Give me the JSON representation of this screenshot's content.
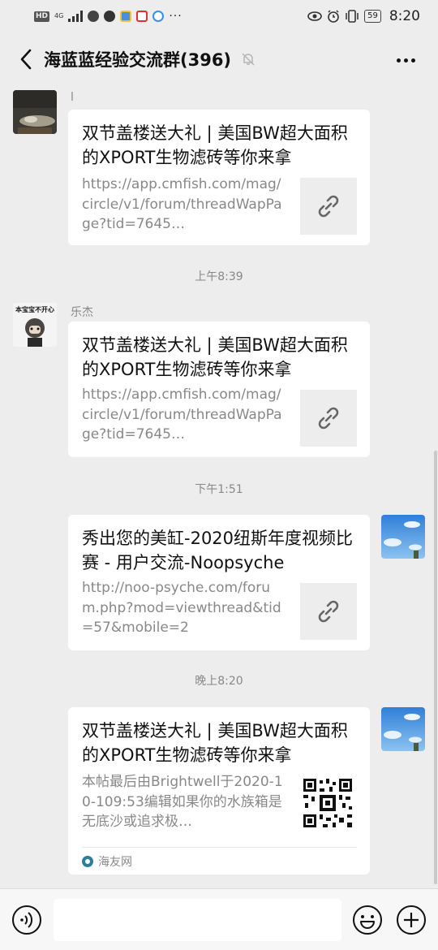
{
  "status_bar": {
    "left_badges": [
      "HD",
      "4G"
    ],
    "more": "···",
    "battery": "59",
    "time": "8:20"
  },
  "header": {
    "title": "海蓝蓝经验交流群(396)",
    "icons": [
      "back-icon",
      "mute-bell-icon",
      "more-icon"
    ]
  },
  "messages": [
    {
      "sender": "l",
      "title": "双节盖楼送大礼 | 美国BW超大面积的XPORT生物滤砖等你来拿",
      "desc": "https://app.cmfish.com/mag/circle/v1/forum/threadWapPage?tid=7645…"
    },
    {
      "timestamp": "上午8:39"
    },
    {
      "sender": "乐杰",
      "avatar_text": "本宝宝不开心",
      "title": "双节盖楼送大礼 | 美国BW超大面积的XPORT生物滤砖等你来拿",
      "desc": "https://app.cmfish.com/mag/circle/v1/forum/threadWapPage?tid=7645…"
    },
    {
      "timestamp": "下午1:51"
    },
    {
      "title": "秀出您的美缸-2020纽斯年度视频比赛 - 用户交流-Noopsyche",
      "desc": "http://noo-psyche.com/forum.php?mod=viewthread&tid=57&mobile=2"
    },
    {
      "timestamp": "晚上8:20"
    },
    {
      "title": "双节盖楼送大礼 | 美国BW超大面积的XPORT生物滤砖等你来拿",
      "desc": "本帖最后由Brightwell于2020-10-109:53编辑如果你的水族箱是无底沙或追求极…",
      "source": "海友网"
    }
  ],
  "input_bar": {
    "placeholder": "",
    "icons": [
      "voice-icon",
      "emoji-icon",
      "plus-icon"
    ]
  },
  "colors": {
    "background": "#ededed",
    "card": "#ffffff",
    "muted_text": "#888888"
  }
}
